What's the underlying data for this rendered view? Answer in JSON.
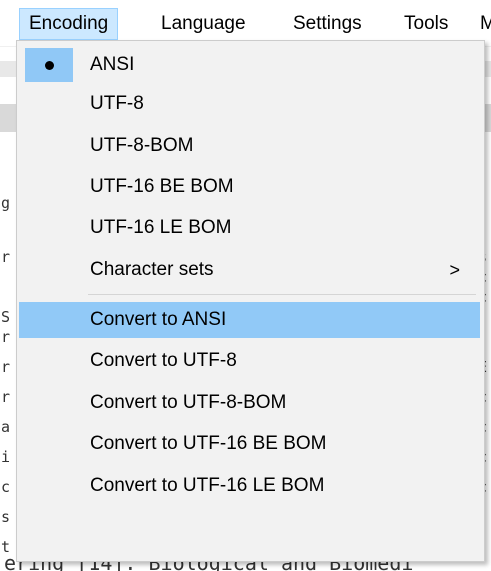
{
  "menubar": {
    "items": [
      "Encoding",
      "Language",
      "Settings",
      "Tools",
      "M"
    ]
  },
  "editor": {
    "bottom_text": "ering [14]. Biological and Biomedi",
    "left_chars": [
      "g",
      "r",
      "S",
      "r",
      "r",
      "r",
      "a",
      "i",
      "c",
      "s",
      "t"
    ],
    "right_chars": [
      "s",
      "c",
      "c",
      "E",
      "c",
      "c",
      "c",
      "c"
    ]
  },
  "encoding_menu": {
    "items": [
      {
        "label": "ANSI",
        "checked": true
      },
      {
        "label": "UTF-8"
      },
      {
        "label": "UTF-8-BOM"
      },
      {
        "label": "UTF-16 BE BOM"
      },
      {
        "label": "UTF-16 LE BOM"
      },
      {
        "label": "Character sets",
        "submenu": true
      }
    ],
    "submenu_arrow": ">",
    "convert_items": [
      {
        "label": "Convert to ANSI",
        "highlighted": true
      },
      {
        "label": "Convert to UTF-8"
      },
      {
        "label": "Convert to UTF-8-BOM"
      },
      {
        "label": "Convert to UTF-16 BE BOM"
      },
      {
        "label": "Convert to UTF-16 LE BOM"
      }
    ]
  },
  "colors": {
    "menu_active_bg": "#cce8ff",
    "item_highlight_bg": "#91c9f7",
    "menu_bg": "#f2f2f2"
  }
}
